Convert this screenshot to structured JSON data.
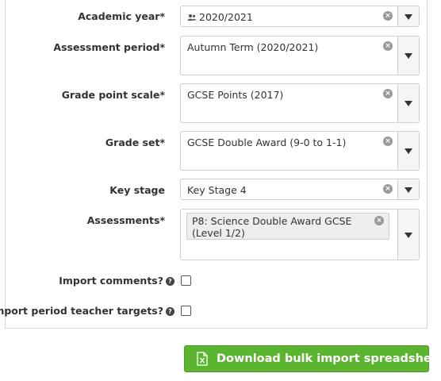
{
  "form": {
    "academic_year": {
      "label": "Academic year*",
      "value": "2020/2021",
      "icon": "users-icon"
    },
    "assessment_period": {
      "label": "Assessment period*",
      "value": "Autumn Term (2020/2021)"
    },
    "grade_point_scale": {
      "label": "Grade point scale*",
      "value": "GCSE Points (2017)"
    },
    "grade_set": {
      "label": "Grade set*",
      "value": "GCSE Double Award (9-0 to 1-1)"
    },
    "key_stage": {
      "label": "Key stage",
      "value": "Key Stage 4"
    },
    "assessments": {
      "label": "Assessments*",
      "tags": [
        "P8: Science Double Award GCSE (Level 1/2)"
      ]
    },
    "import_comments": {
      "label": "Import comments?",
      "checked": false
    },
    "import_targets": {
      "label": "Import period teacher targets?",
      "checked": false
    },
    "clear_symbol": "×",
    "help_symbol": "?"
  },
  "actions": {
    "download_label": "Download bulk import spreadsheet",
    "button_color": "#5cb531"
  }
}
